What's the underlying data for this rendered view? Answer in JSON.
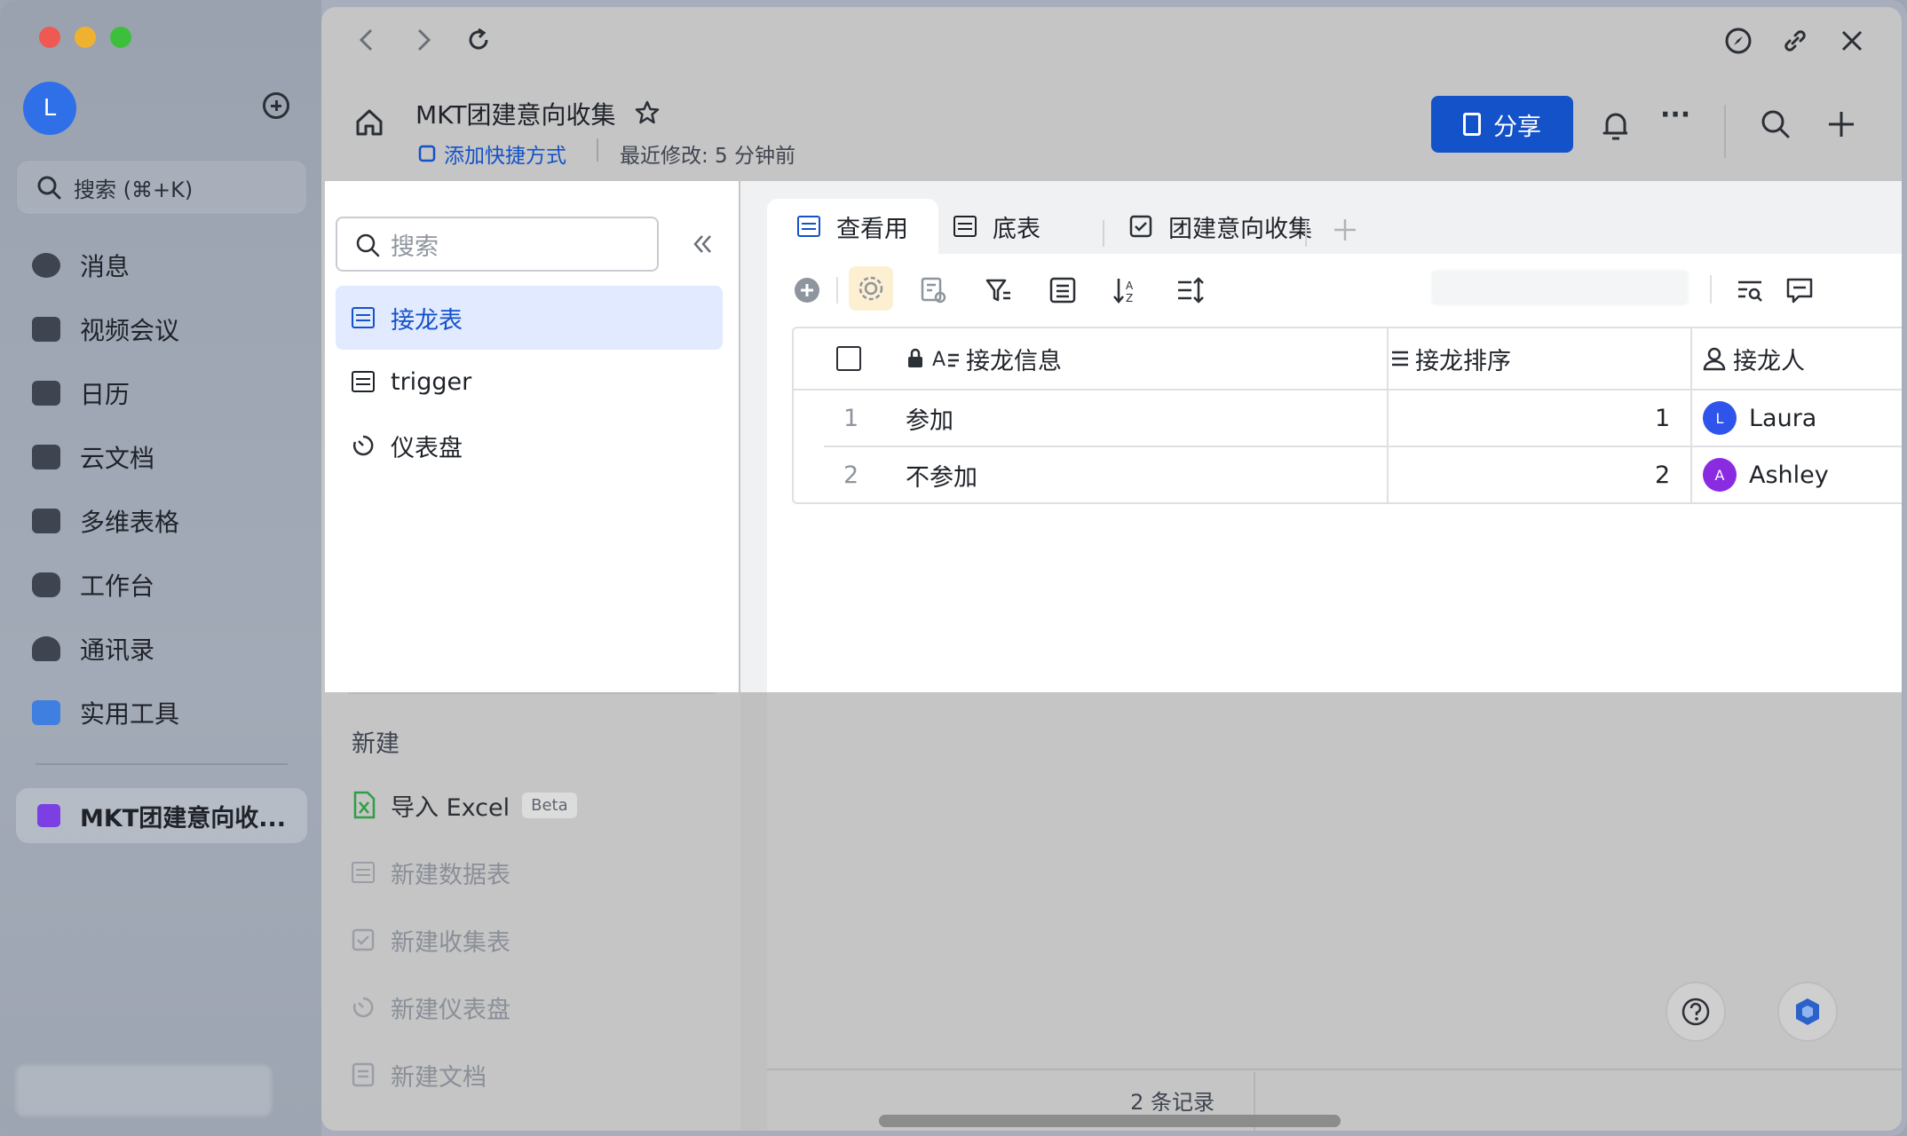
{
  "window": {
    "traffic_colors": [
      "#ee5a52",
      "#f0b130",
      "#3cc03c"
    ]
  },
  "sidebar": {
    "avatar_letter": "L",
    "search_placeholder": "搜索 (⌘+K)",
    "items": [
      {
        "label": "消息",
        "icon": "chat-icon"
      },
      {
        "label": "视频会议",
        "icon": "video-icon"
      },
      {
        "label": "日历",
        "icon": "calendar-icon"
      },
      {
        "label": "云文档",
        "icon": "cloud-doc-icon"
      },
      {
        "label": "多维表格",
        "icon": "base-icon"
      },
      {
        "label": "工作台",
        "icon": "workplace-icon"
      },
      {
        "label": "通讯录",
        "icon": "contacts-icon"
      },
      {
        "label": "实用工具",
        "icon": "tools-icon"
      }
    ],
    "active_doc": "MKT团建意向收..."
  },
  "header": {
    "title": "MKT团建意向收集",
    "add_shortcut": "添加快捷方式",
    "last_modified": "最近修改: 5 分钟前",
    "share_label": "分享",
    "more_label": "···"
  },
  "left_panel": {
    "search_placeholder": "搜索",
    "items": [
      {
        "label": "接龙表",
        "active": true
      },
      {
        "label": "trigger"
      },
      {
        "label": "仪表盘"
      }
    ],
    "create_title": "新建",
    "create_items": [
      {
        "label": "导入 Excel",
        "badge": "Beta"
      },
      {
        "label": "新建数据表"
      },
      {
        "label": "新建收集表"
      },
      {
        "label": "新建仪表盘"
      },
      {
        "label": "新建文档"
      }
    ]
  },
  "tabs": [
    {
      "label": "查看用",
      "active": true
    },
    {
      "label": "底表"
    },
    {
      "label": "团建意向收集"
    }
  ],
  "table": {
    "columns": [
      "接龙信息",
      "接龙排序",
      "接龙人"
    ],
    "rows": [
      {
        "index": "1",
        "info": "参加",
        "order": "1",
        "person": "Laura",
        "avatar": "L",
        "avatar_color": "#2f54eb"
      },
      {
        "index": "2",
        "info": "不参加",
        "order": "2",
        "person": "Ashley",
        "avatar": "A",
        "avatar_color": "#8a2be2"
      }
    ]
  },
  "footer": {
    "record_count": "2 条记录"
  },
  "colors": {
    "accent": "#1452c9",
    "active_bg": "#e1eaff"
  }
}
